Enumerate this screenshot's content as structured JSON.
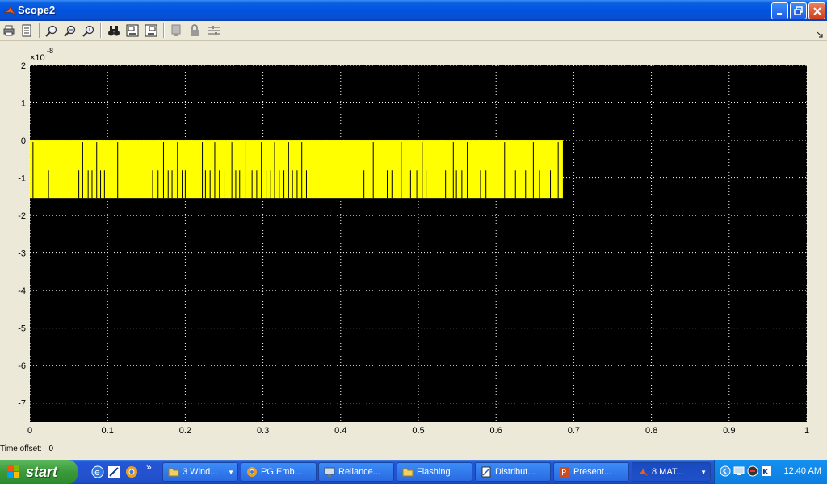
{
  "window": {
    "title": "Scope2",
    "icon": "matlab-icon",
    "buttons": [
      "minimize-icon",
      "maximize-icon",
      "close-icon"
    ]
  },
  "toolbar": {
    "buttons": [
      "print-icon",
      "parameters-icon",
      "zoom-icon",
      "zoom-x-icon",
      "zoom-y-icon",
      "autoscale-binoculars-icon",
      "save-axes-icon",
      "restore-axes-icon",
      "floating-scope-icon",
      "lock-icon",
      "signal-selection-icon"
    ]
  },
  "status": {
    "label": "Time offset:",
    "value": "0"
  },
  "chart_data": {
    "type": "line",
    "xlim": [
      0,
      1
    ],
    "ylim": [
      -7.5,
      2
    ],
    "y_exponent_label": "×10",
    "y_exponent": "-8",
    "xticks": [
      "0",
      "0.1",
      "0.2",
      "0.3",
      "0.4",
      "0.5",
      "0.6",
      "0.7",
      "0.8",
      "0.9",
      "1"
    ],
    "yticks": [
      "2",
      "1",
      "0",
      "-1",
      "-2",
      "-3",
      "-4",
      "-5",
      "-6",
      "-7"
    ],
    "grid": true,
    "background": "#000000",
    "series": [
      {
        "color": "#ffff00",
        "signal_x_range": [
          0,
          0.686
        ],
        "high_level": 0,
        "low_level": -1.55,
        "mid_level": -0.8,
        "gap_x_values": [
          0.004,
          0.024,
          0.063,
          0.068,
          0.075,
          0.08,
          0.086,
          0.091,
          0.096,
          0.113,
          0.158,
          0.165,
          0.172,
          0.178,
          0.183,
          0.19,
          0.196,
          0.2,
          0.222,
          0.226,
          0.232,
          0.238,
          0.244,
          0.251,
          0.26,
          0.265,
          0.27,
          0.278,
          0.286,
          0.292,
          0.298,
          0.305,
          0.31,
          0.315,
          0.321,
          0.327,
          0.333,
          0.338,
          0.344,
          0.35,
          0.356,
          0.43,
          0.442,
          0.46,
          0.466,
          0.478,
          0.49,
          0.498,
          0.505,
          0.51,
          0.535,
          0.545,
          0.549,
          0.556,
          0.563,
          0.58,
          0.587,
          0.611,
          0.625,
          0.638,
          0.648,
          0.656,
          0.67,
          0.68
        ]
      }
    ]
  },
  "taskbar": {
    "start_label": "start",
    "quicklaunch": [
      "ie-icon",
      "notepad-icon",
      "chrome-icon"
    ],
    "overflow": "»",
    "tasks": [
      {
        "label": "3 Wind...",
        "icon": "folder-icon",
        "has_menu": true
      },
      {
        "label": "PG Emb...",
        "icon": "chrome-icon"
      },
      {
        "label": "Reliance...",
        "icon": "network-icon"
      },
      {
        "label": "Flashing",
        "icon": "folder-icon"
      },
      {
        "label": "Distribut...",
        "icon": "document-icon"
      },
      {
        "label": "Present...",
        "icon": "powerpoint-icon"
      },
      {
        "label": "8 MAT...",
        "icon": "matlab-icon",
        "has_menu": true,
        "active": true
      }
    ],
    "clock": "12:40 AM"
  }
}
